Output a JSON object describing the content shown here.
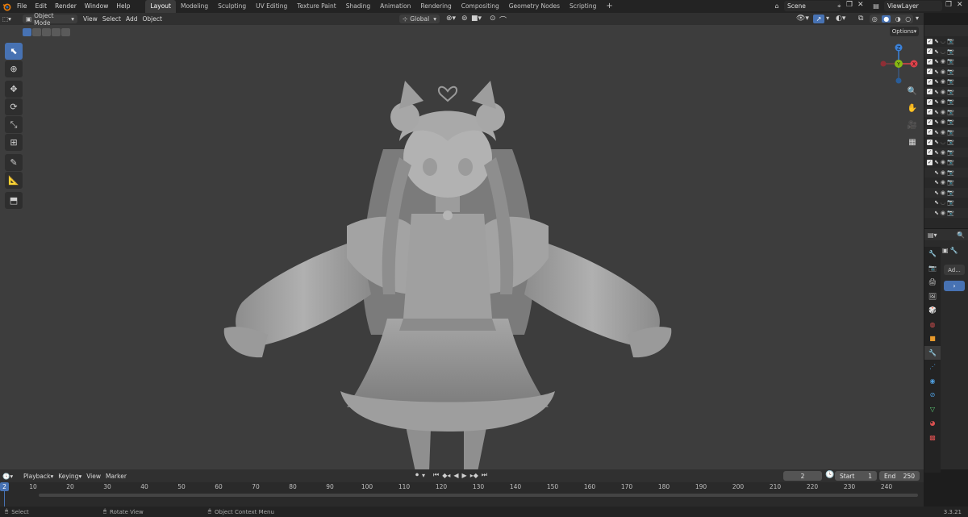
{
  "menu": {
    "file": "File",
    "edit": "Edit",
    "render": "Render",
    "window": "Window",
    "help": "Help"
  },
  "workspaces": [
    "Layout",
    "Modeling",
    "Sculpting",
    "UV Editing",
    "Texture Paint",
    "Shading",
    "Animation",
    "Rendering",
    "Compositing",
    "Geometry Nodes",
    "Scripting"
  ],
  "active_workspace": "Layout",
  "scene": {
    "name": "Scene"
  },
  "view_layer": {
    "name": "ViewLayer"
  },
  "viewport_header": {
    "mode": "Object Mode",
    "view": "View",
    "select": "Select",
    "add": "Add",
    "object": "Object",
    "orientation": "Global",
    "options": "Options"
  },
  "gizmo": {
    "x": "X",
    "y": "Y",
    "z": "Z"
  },
  "properties": {
    "add_modifier": "Ad..."
  },
  "timeline": {
    "playback": "Playback",
    "keying": "Keying",
    "view": "View",
    "marker": "Marker",
    "current_frame": "2",
    "start_label": "Start",
    "start_value": "1",
    "end_label": "End",
    "end_value": "250",
    "ruler_frame": "2",
    "ticks": [
      "10",
      "20",
      "30",
      "40",
      "50",
      "60",
      "70",
      "80",
      "90",
      "100",
      "110",
      "120",
      "130",
      "140",
      "150",
      "160",
      "170",
      "180",
      "190",
      "200",
      "210",
      "220",
      "230",
      "240"
    ]
  },
  "status": {
    "select": "Select",
    "rotate": "Rotate View",
    "context": "Object Context Menu",
    "version": "3.3.21"
  },
  "colors": {
    "accent": "#4772b3",
    "x_axis": "#e0424b",
    "y_axis": "#87b814",
    "z_axis": "#3b81d8"
  }
}
